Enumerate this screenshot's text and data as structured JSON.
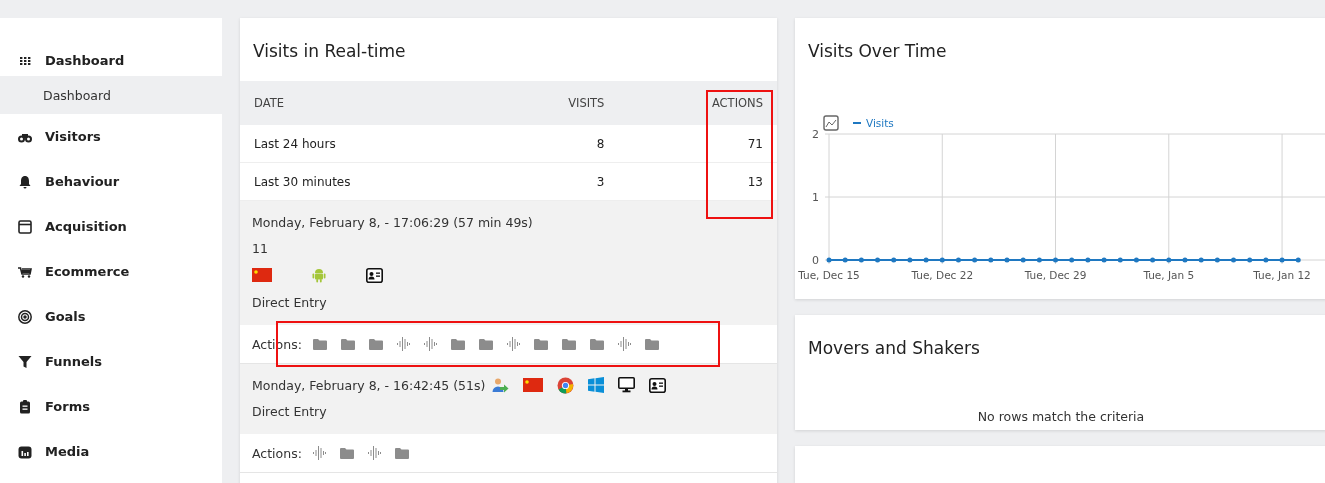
{
  "sidebar": {
    "items": [
      {
        "label": "Dashboard",
        "selected": false,
        "children": [
          {
            "label": "Dashboard",
            "selected": true
          }
        ]
      },
      {
        "label": "Visitors",
        "selected": false
      },
      {
        "label": "Behaviour",
        "selected": false
      },
      {
        "label": "Acquisition",
        "selected": false
      },
      {
        "label": "Ecommerce",
        "selected": false
      },
      {
        "label": "Goals",
        "selected": false
      },
      {
        "label": "Funnels",
        "selected": false
      },
      {
        "label": "Forms",
        "selected": false
      },
      {
        "label": "Media",
        "selected": false
      }
    ]
  },
  "realtime": {
    "title": "Visits in Real-time",
    "columns": [
      {
        "label": "DATE"
      },
      {
        "label": "VISITS"
      },
      {
        "label": "ACTIONS",
        "highlight": true
      }
    ],
    "rows": [
      {
        "cells": [
          "Last 24 hours",
          "8",
          "71"
        ]
      },
      {
        "cells": [
          "Last 30 minutes",
          "3",
          "13"
        ]
      }
    ],
    "visits": [
      {
        "datetime": "Monday, February 8, - 17:06:29 (57 min 49s)",
        "visitor": "11",
        "icons": [
          {
            "kind": "flag"
          },
          {
            "kind": "android"
          },
          {
            "kind": "card"
          }
        ],
        "referrer": "Direct Entry",
        "actions_label": "Actions:",
        "actions": [
          {
            "kind": "folder"
          },
          {
            "kind": "folder"
          },
          {
            "kind": "folder"
          },
          {
            "kind": "audio"
          },
          {
            "kind": "audio"
          },
          {
            "kind": "folder"
          },
          {
            "kind": "folder"
          },
          {
            "kind": "audio"
          },
          {
            "kind": "folder"
          },
          {
            "kind": "folder"
          },
          {
            "kind": "folder"
          },
          {
            "kind": "audio"
          },
          {
            "kind": "folder"
          }
        ],
        "highlight": true
      },
      {
        "datetime": "Monday, February 8, - 16:42:45 (51s)",
        "icons": [
          {
            "kind": "person"
          },
          {
            "kind": "flag"
          },
          {
            "kind": "chrome"
          },
          {
            "kind": "windows"
          },
          {
            "kind": "monitor"
          },
          {
            "kind": "card"
          }
        ],
        "referrer": "Direct Entry",
        "actions_label": "Actions:",
        "actions": [
          {
            "kind": "audio"
          },
          {
            "kind": "folder"
          },
          {
            "kind": "audio"
          },
          {
            "kind": "folder"
          }
        ]
      }
    ]
  },
  "visits_over_time": {
    "title": "Visits Over Time",
    "chart_data": {
      "type": "line",
      "categories": [
        "Tue, Dec 15",
        null,
        null,
        null,
        null,
        null,
        null,
        "Tue, Dec 22",
        null,
        null,
        null,
        null,
        null,
        null,
        "Tue, Dec 29",
        null,
        null,
        null,
        null,
        null,
        null,
        "Tue, Jan 5",
        null,
        null,
        null,
        null,
        null,
        null,
        "Tue, Jan 12",
        null
      ],
      "series": [
        {
          "name": "Visits",
          "color": "#1f78c1",
          "values": [
            0,
            0,
            0,
            0,
            0,
            0,
            0,
            0,
            0,
            0,
            0,
            0,
            0,
            0,
            0,
            0,
            0,
            0,
            0,
            0,
            0,
            0,
            0,
            0,
            0,
            0,
            0,
            0,
            0,
            0
          ]
        }
      ],
      "ylim": [
        0,
        2
      ],
      "yticks": [
        0,
        1,
        2
      ],
      "grid": true
    }
  },
  "movers": {
    "title": "Movers and Shakers",
    "message": "No rows match the criteria"
  }
}
